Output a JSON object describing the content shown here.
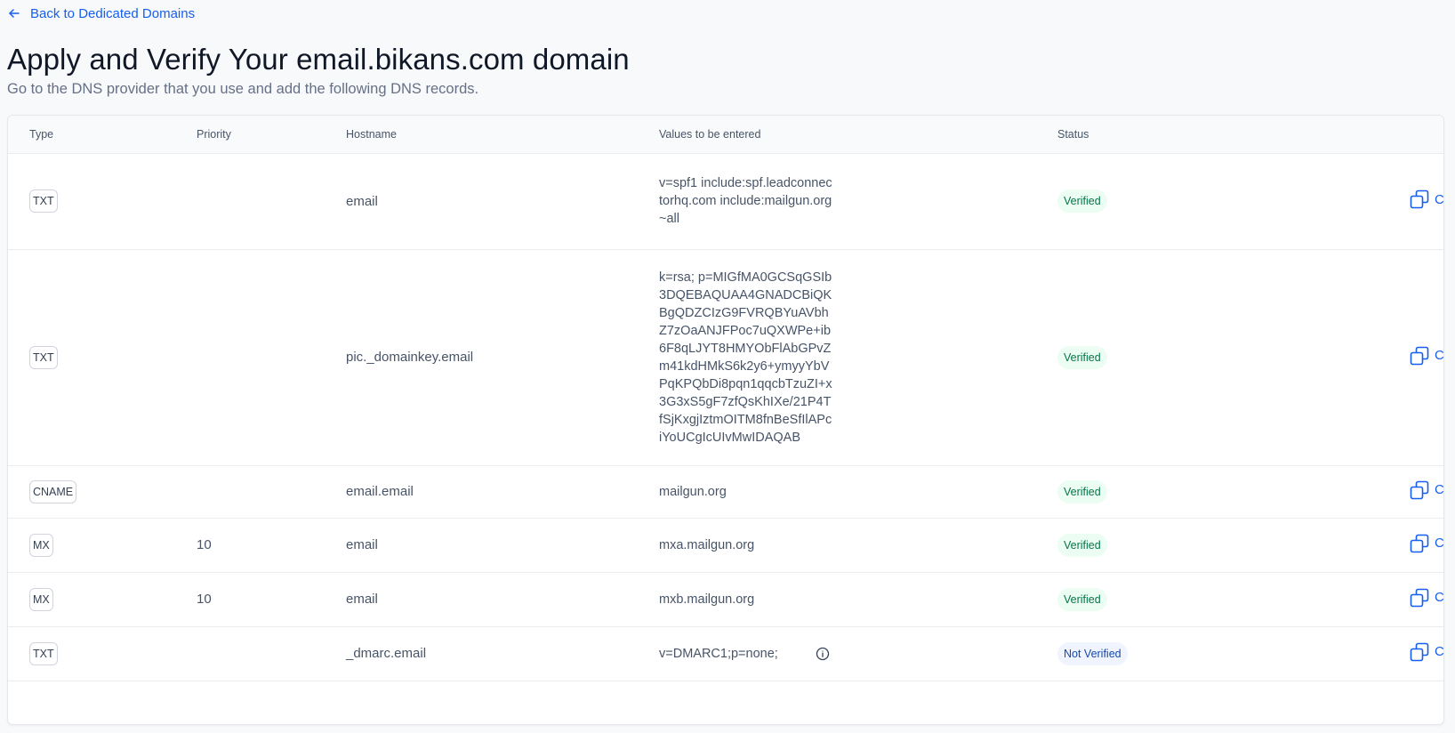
{
  "nav": {
    "back_label": "Back to Dedicated Domains"
  },
  "header": {
    "title": "Apply and Verify Your email.bikans.com domain",
    "subtitle": "Go to the DNS provider that you use and add the following DNS records."
  },
  "table": {
    "columns": {
      "type": "Type",
      "priority": "Priority",
      "hostname": "Hostname",
      "values": "Values to be entered",
      "status": "Status"
    },
    "copy_label": "Copy",
    "rows": [
      {
        "type": "TXT",
        "priority": "",
        "hostname": "email",
        "value": "v=spf1 include:spf.leadconnectorhq.com include:mailgun.org ~all",
        "status": "Verified"
      },
      {
        "type": "TXT",
        "priority": "",
        "hostname": "pic._domainkey.email",
        "value": "k=rsa; p=MIGfMA0GCSqGSIb3DQEBAQUAA4GNADCBiQKBgQDZCIzG9FVRQBYuAVbhZ7zOaANJFPoc7uQXWPe+ib6F8qLJYT8HMYObFlAbGPvZm41kdHMkS6k2y6+ymyyYbVPqKPQbDi8pqn1qqcbTzuZI+x3G3xS5gF7zfQsKhIXe/21P4TfSjKxgjIztmOITM8fnBeSfIlAPciYoUCgIcUIvMwIDAQAB",
        "status": "Verified"
      },
      {
        "type": "CNAME",
        "priority": "",
        "hostname": "email.email",
        "value": "mailgun.org",
        "status": "Verified"
      },
      {
        "type": "MX",
        "priority": "10",
        "hostname": "email",
        "value": "mxa.mailgun.org",
        "status": "Verified"
      },
      {
        "type": "MX",
        "priority": "10",
        "hostname": "email",
        "value": "mxb.mailgun.org",
        "status": "Verified"
      },
      {
        "type": "TXT",
        "priority": "",
        "hostname": "_dmarc.email",
        "value": "v=DMARC1;p=none;",
        "status": "Not Verified"
      }
    ]
  },
  "colors": {
    "accent": "#155eef",
    "verified_bg": "#ecfdf3",
    "verified_text": "#067647",
    "not_verified_bg": "#eff4ff",
    "not_verified_text": "#1849a9"
  },
  "icons": {
    "back": "arrow-left-icon",
    "copy": "copy-icon",
    "info": "info-icon"
  }
}
